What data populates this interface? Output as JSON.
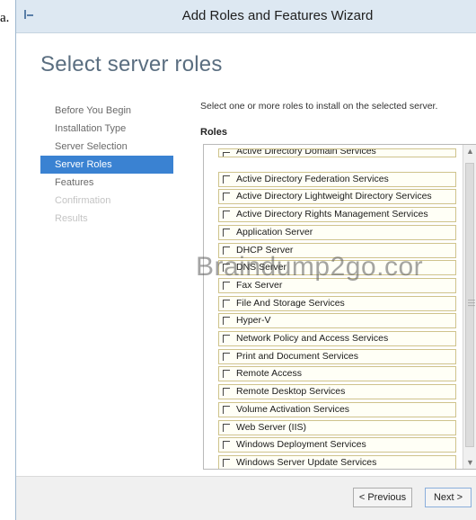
{
  "stray_text": "a.",
  "window": {
    "title": "Add Roles and Features Wizard"
  },
  "heading": "Select server roles",
  "nav": {
    "items": [
      {
        "label": "Before You Begin",
        "state": "normal"
      },
      {
        "label": "Installation Type",
        "state": "normal"
      },
      {
        "label": "Server Selection",
        "state": "normal"
      },
      {
        "label": "Server Roles",
        "state": "active"
      },
      {
        "label": "Features",
        "state": "normal"
      },
      {
        "label": "Confirmation",
        "state": "disabled"
      },
      {
        "label": "Results",
        "state": "disabled"
      }
    ]
  },
  "instruction": "Select one or more roles to install on the selected server.",
  "roles_label": "Roles",
  "roles": [
    "Active Directory Domain Services",
    "Active Directory Federation Services",
    "Active Directory Lightweight Directory Services",
    "Active Directory Rights Management Services",
    "Application Server",
    "DHCP Server",
    "DNS Server",
    "Fax Server",
    "File And Storage Services",
    "Hyper-V",
    "Network Policy and Access Services",
    "Print and Document Services",
    "Remote Access",
    "Remote Desktop Services",
    "Volume Activation Services",
    "Web Server (IIS)",
    "Windows Deployment Services",
    "Windows Server Update Services"
  ],
  "watermark": "Braindump2go.cor",
  "buttons": {
    "previous": "< Previous",
    "next": "Next >"
  },
  "colors": {
    "accent": "#3a82d2",
    "heading": "#5a6e80",
    "titlebar": "#dde8f2"
  }
}
